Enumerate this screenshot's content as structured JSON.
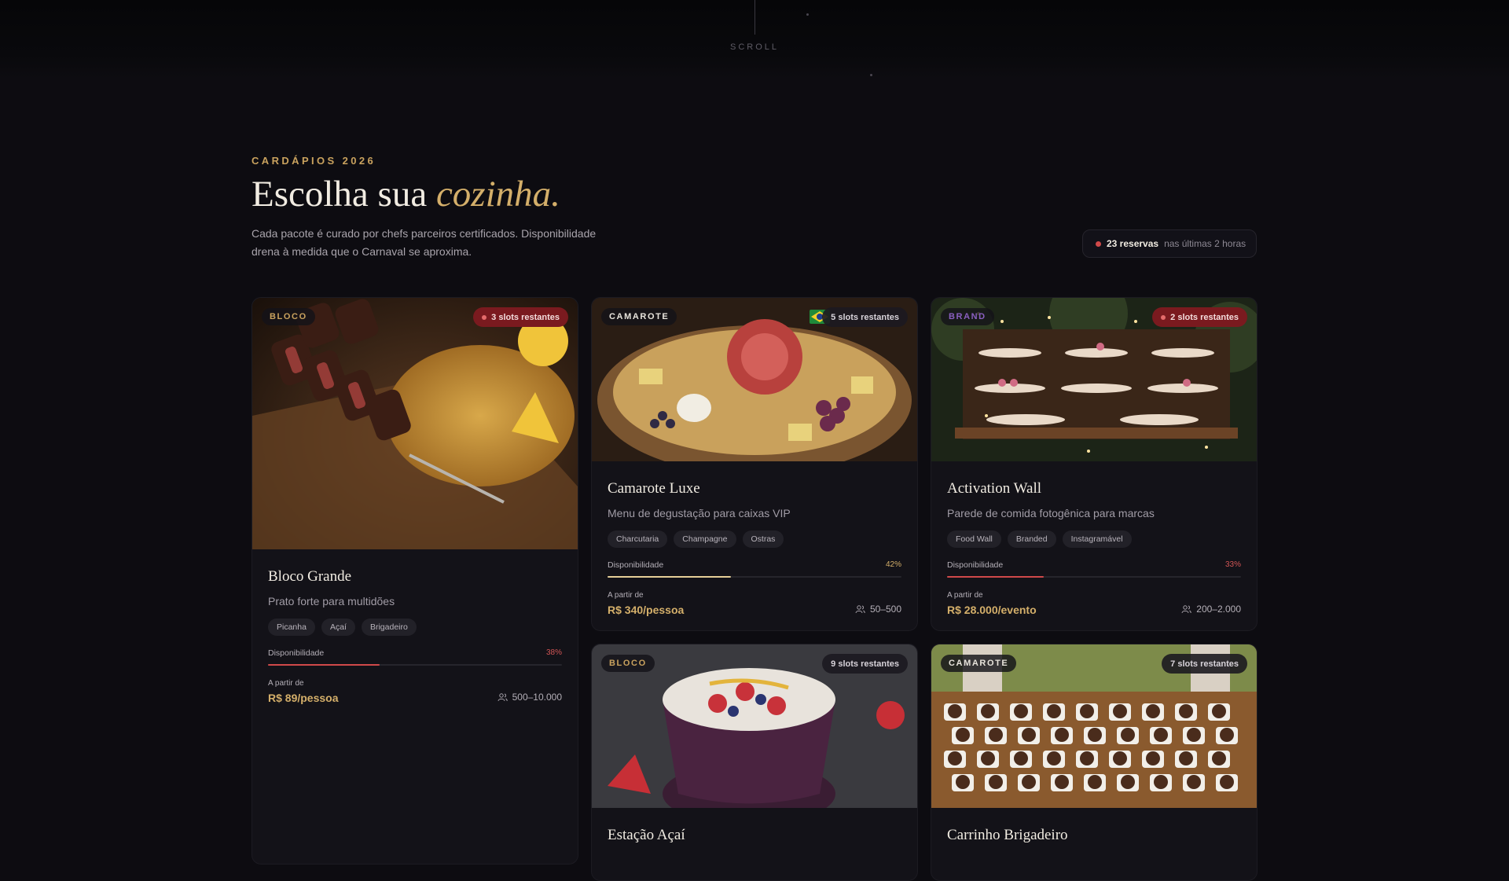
{
  "scroll": {
    "label": "SCROLL"
  },
  "section": {
    "eyebrow": "CARDÁPIOS 2026",
    "headline_plain": "Escolha sua ",
    "headline_italic": "cozinha.",
    "lede": "Cada pacote é curado por chefs parceiros certificados. Disponibilidade drena à medida que o Carnaval se aproxima."
  },
  "activity": {
    "count": "23 reservas",
    "rest": "nas últimas 2 horas"
  },
  "colors": {
    "gold": "#d4af6a",
    "alert": "#d04949",
    "camarote": "#e8e4dc",
    "bloco": "#c9a25e",
    "brand": "#8a5fc0"
  },
  "cards": [
    {
      "category": "BLOCO",
      "slots": "3 slots restantes",
      "title": "Bloco Grande",
      "subtitle": "Prato forte para multidões",
      "tags": [
        "Picanha",
        "Açaí",
        "Brigadeiro"
      ],
      "availability_label": "Disponibilidade",
      "availability_pct": "38%",
      "price_label": "A partir de",
      "price": "R$ 89/pessoa",
      "guests": "500–10.000",
      "image": "grilled-meat-farofa"
    },
    {
      "category": "CAMAROTE",
      "slots": "5 slots restantes",
      "title": "Camarote Luxe",
      "subtitle": "Menu de degustação para caixas VIP",
      "tags": [
        "Charcutaria",
        "Champagne",
        "Ostras"
      ],
      "availability_label": "Disponibilidade",
      "availability_pct": "42%",
      "price_label": "A partir de",
      "price": "R$ 340/pessoa",
      "guests": "50–500",
      "image": "charcuterie-board"
    },
    {
      "category": "BRAND",
      "slots": "2 slots restantes",
      "title": "Activation Wall",
      "subtitle": "Parede de comida fotogênica para marcas",
      "tags": [
        "Food Wall",
        "Branded",
        "Instagramável"
      ],
      "availability_label": "Disponibilidade",
      "availability_pct": "33%",
      "price_label": "A partir de",
      "price": "R$ 28.000/evento",
      "guests": "200–2.000",
      "image": "dessert-wall"
    },
    {
      "category": "BLOCO",
      "slots": "9 slots restantes",
      "title": "Estação Açaí",
      "image": "acai-bowl"
    },
    {
      "category": "CAMAROTE",
      "slots": "7 slots restantes",
      "title": "Carrinho Brigadeiro",
      "image": "brigadeiro-tray"
    }
  ]
}
